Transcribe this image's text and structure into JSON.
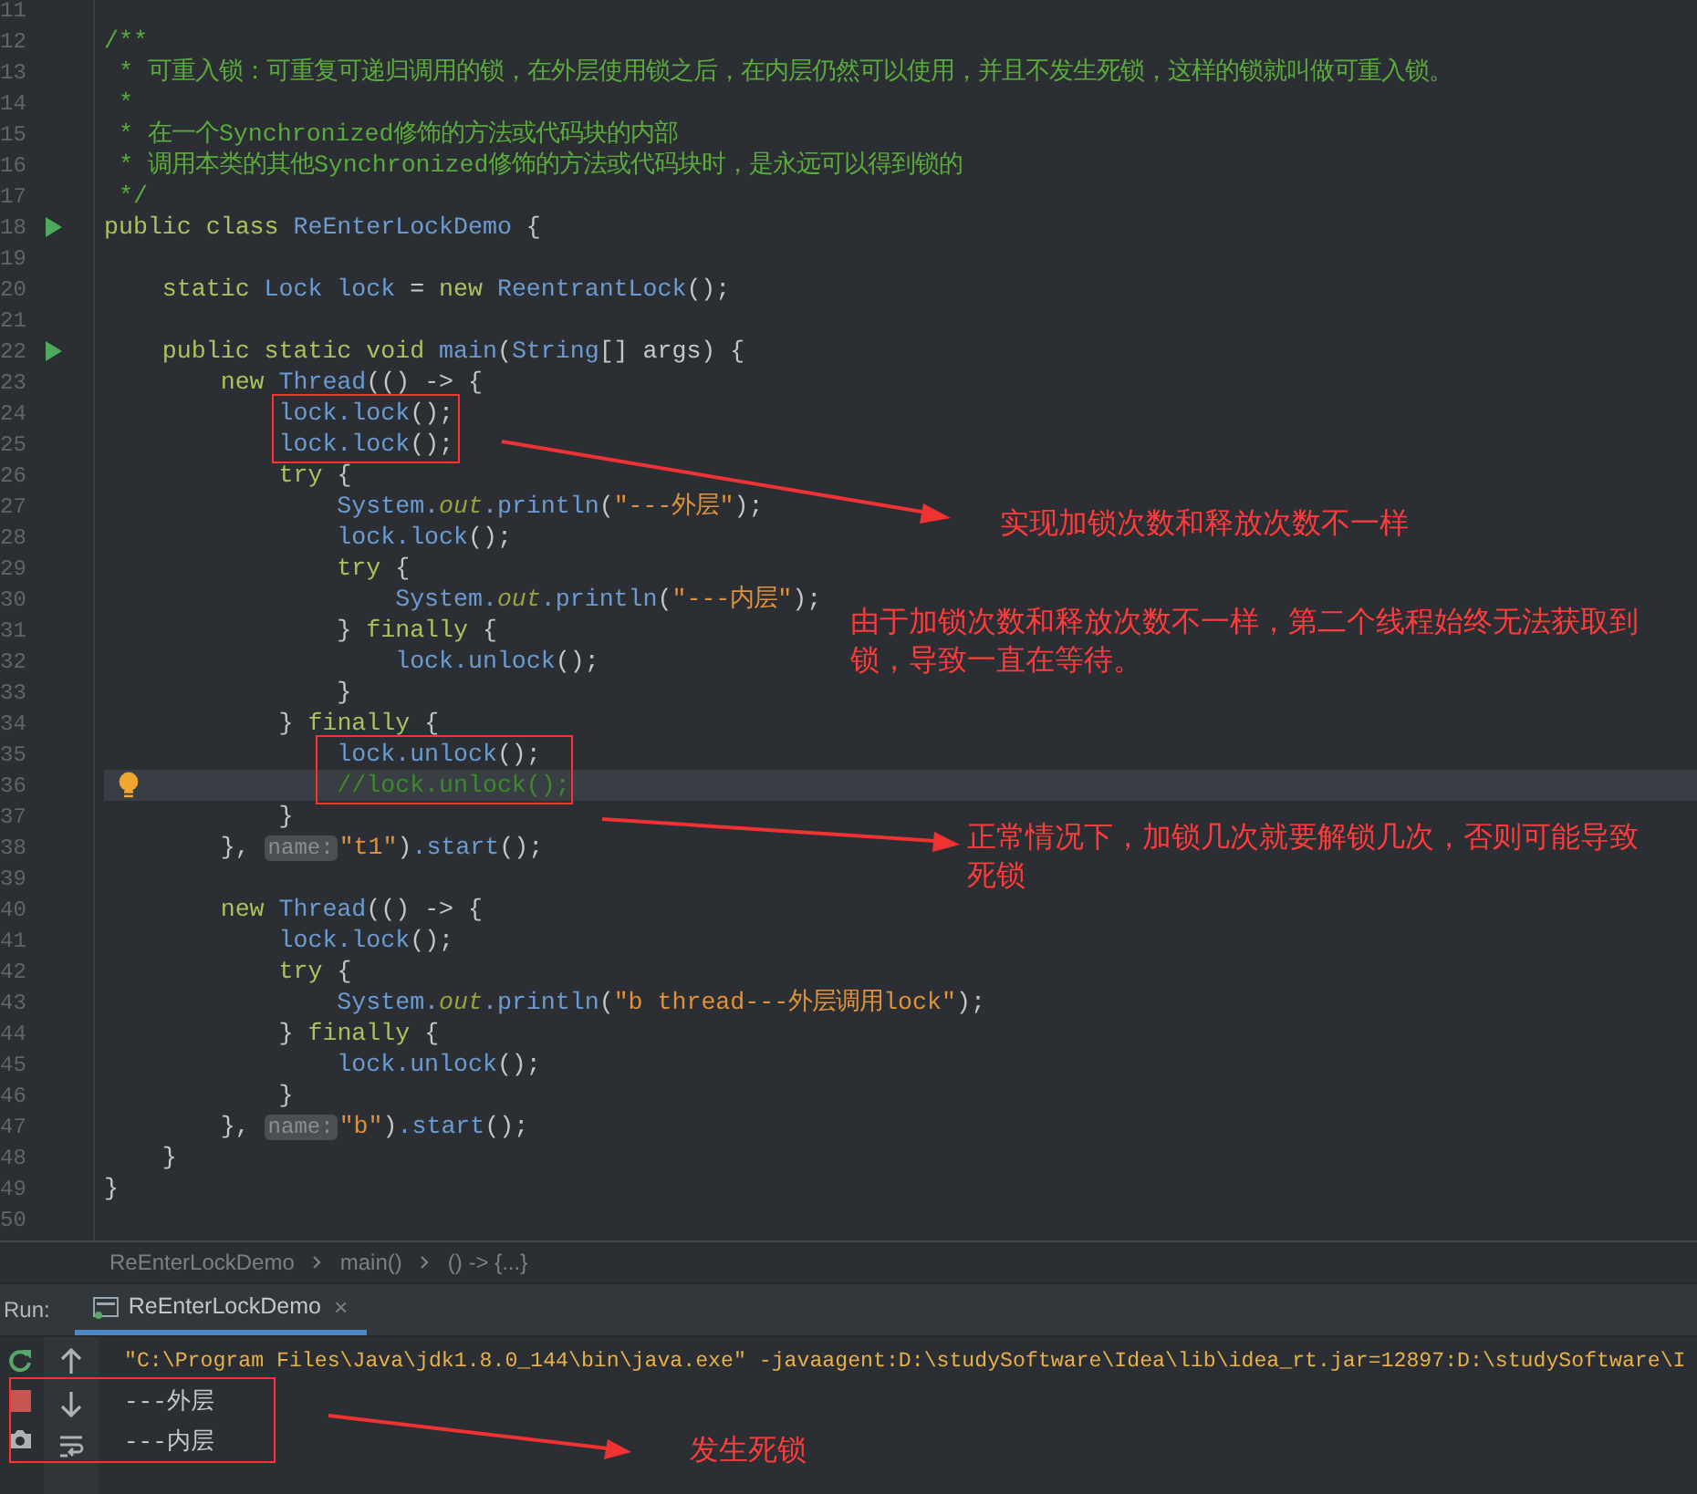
{
  "editor": {
    "lines": [
      {
        "number": "11",
        "current": false
      },
      {
        "number": "12",
        "current": false,
        "tokens": [
          {
            "text": "/**",
            "kind": "comment"
          }
        ]
      },
      {
        "number": "13",
        "current": false,
        "tokens": [
          {
            "text": " * 可重入锁：可重复可递归调用的锁，在外层使用锁之后，在内层仍然可以使用，并且不发生死锁，这样的锁就叫做可重入锁。",
            "kind": "comment"
          }
        ]
      },
      {
        "number": "14",
        "current": false,
        "tokens": [
          {
            "text": " *",
            "kind": "comment"
          }
        ]
      },
      {
        "number": "15",
        "current": false,
        "tokens": [
          {
            "text": " * 在一个Synchronized修饰的方法或代码块的内部",
            "kind": "comment"
          }
        ]
      },
      {
        "number": "16",
        "current": false,
        "tokens": [
          {
            "text": " * 调用本类的其他Synchronized修饰的方法或代码块时，是永远可以得到锁的",
            "kind": "comment"
          }
        ]
      },
      {
        "number": "17",
        "current": false,
        "tokens": [
          {
            "text": " */",
            "kind": "comment"
          }
        ]
      },
      {
        "number": "18",
        "current": false,
        "run_icon": true,
        "tokens": [
          {
            "text": "public class ",
            "kind": "keyword"
          },
          {
            "text": "ReEnterLockDemo",
            "kind": "identifier"
          },
          {
            "text": " {",
            "kind": "plain"
          }
        ]
      },
      {
        "number": "19",
        "current": false
      },
      {
        "number": "20",
        "current": false,
        "tokens": [
          {
            "text": "    static ",
            "kind": "keyword"
          },
          {
            "text": "Lock lock ",
            "kind": "identifier"
          },
          {
            "text": "= ",
            "kind": "plain"
          },
          {
            "text": "new ",
            "kind": "keyword"
          },
          {
            "text": "ReentrantLock",
            "kind": "identifier"
          },
          {
            "text": "();",
            "kind": "plain"
          }
        ]
      },
      {
        "number": "21",
        "current": false
      },
      {
        "number": "22",
        "current": false,
        "run_icon": true,
        "tokens": [
          {
            "text": "    public static void ",
            "kind": "keyword"
          },
          {
            "text": "main",
            "kind": "identifier"
          },
          {
            "text": "(",
            "kind": "plain"
          },
          {
            "text": "String",
            "kind": "identifier"
          },
          {
            "text": "[] args) {",
            "kind": "plain"
          }
        ]
      },
      {
        "number": "23",
        "current": false,
        "tokens": [
          {
            "text": "        new ",
            "kind": "keyword"
          },
          {
            "text": "Thread",
            "kind": "identifier"
          },
          {
            "text": "(() -> {",
            "kind": "plain"
          }
        ]
      },
      {
        "number": "24",
        "current": false,
        "tokens": [
          {
            "text": "            lock.lock",
            "kind": "identifier"
          },
          {
            "text": "();",
            "kind": "plain"
          }
        ]
      },
      {
        "number": "25",
        "current": false,
        "tokens": [
          {
            "text": "            lock.lock",
            "kind": "identifier"
          },
          {
            "text": "();",
            "kind": "plain"
          }
        ]
      },
      {
        "number": "26",
        "current": false,
        "tokens": [
          {
            "text": "            try ",
            "kind": "keyword"
          },
          {
            "text": "{",
            "kind": "plain"
          }
        ]
      },
      {
        "number": "27",
        "current": false,
        "tokens": [
          {
            "text": "                System.",
            "kind": "identifier"
          },
          {
            "text": "out",
            "kind": "field"
          },
          {
            "text": ".println",
            "kind": "identifier"
          },
          {
            "text": "(",
            "kind": "plain"
          },
          {
            "text": "\"---外层\"",
            "kind": "string"
          },
          {
            "text": ");",
            "kind": "plain"
          }
        ]
      },
      {
        "number": "28",
        "current": false,
        "tokens": [
          {
            "text": "                lock.lock",
            "kind": "identifier"
          },
          {
            "text": "();",
            "kind": "plain"
          }
        ]
      },
      {
        "number": "29",
        "current": false,
        "tokens": [
          {
            "text": "                try ",
            "kind": "keyword"
          },
          {
            "text": "{",
            "kind": "plain"
          }
        ]
      },
      {
        "number": "30",
        "current": false,
        "tokens": [
          {
            "text": "                    System.",
            "kind": "identifier"
          },
          {
            "text": "out",
            "kind": "field"
          },
          {
            "text": ".println",
            "kind": "identifier"
          },
          {
            "text": "(",
            "kind": "plain"
          },
          {
            "text": "\"---内层\"",
            "kind": "string"
          },
          {
            "text": ");",
            "kind": "plain"
          }
        ]
      },
      {
        "number": "31",
        "current": false,
        "tokens": [
          {
            "text": "                } ",
            "kind": "plain"
          },
          {
            "text": "finally ",
            "kind": "keyword"
          },
          {
            "text": "{",
            "kind": "plain"
          }
        ]
      },
      {
        "number": "32",
        "current": false,
        "tokens": [
          {
            "text": "                    lock.unlock",
            "kind": "identifier"
          },
          {
            "text": "();",
            "kind": "plain"
          }
        ]
      },
      {
        "number": "33",
        "current": false,
        "tokens": [
          {
            "text": "                }",
            "kind": "plain"
          }
        ]
      },
      {
        "number": "34",
        "current": false,
        "tokens": [
          {
            "text": "            } ",
            "kind": "plain"
          },
          {
            "text": "finally ",
            "kind": "keyword"
          },
          {
            "text": "{",
            "kind": "plain"
          }
        ]
      },
      {
        "number": "35",
        "current": false,
        "tokens": [
          {
            "text": "                lock.unlock",
            "kind": "identifier"
          },
          {
            "text": "();",
            "kind": "plain"
          }
        ]
      },
      {
        "number": "36",
        "current": true,
        "bulb_icon": true,
        "tokens": [
          {
            "text": "                //lock.unlock();",
            "kind": "disabled_code"
          }
        ]
      },
      {
        "number": "37",
        "current": false,
        "tokens": [
          {
            "text": "            }",
            "kind": "plain"
          }
        ]
      },
      {
        "number": "38",
        "current": false,
        "tokens": [
          {
            "text": "        }, ",
            "kind": "plain"
          },
          {
            "text": "name:",
            "kind": "hint"
          },
          {
            "text": "\"t1\"",
            "kind": "string"
          },
          {
            "text": ")",
            "kind": "plain"
          },
          {
            "text": ".start",
            "kind": "identifier"
          },
          {
            "text": "();",
            "kind": "plain"
          }
        ]
      },
      {
        "number": "39",
        "current": false
      },
      {
        "number": "40",
        "current": false,
        "tokens": [
          {
            "text": "        new ",
            "kind": "keyword"
          },
          {
            "text": "Thread",
            "kind": "identifier"
          },
          {
            "text": "(() -> {",
            "kind": "plain"
          }
        ]
      },
      {
        "number": "41",
        "current": false,
        "tokens": [
          {
            "text": "            lock.lock",
            "kind": "identifier"
          },
          {
            "text": "();",
            "kind": "plain"
          }
        ]
      },
      {
        "number": "42",
        "current": false,
        "tokens": [
          {
            "text": "            try ",
            "kind": "keyword"
          },
          {
            "text": "{",
            "kind": "plain"
          }
        ]
      },
      {
        "number": "43",
        "current": false,
        "tokens": [
          {
            "text": "                System.",
            "kind": "identifier"
          },
          {
            "text": "out",
            "kind": "field"
          },
          {
            "text": ".println",
            "kind": "identifier"
          },
          {
            "text": "(",
            "kind": "plain"
          },
          {
            "text": "\"b thread---外层调用lock\"",
            "kind": "string"
          },
          {
            "text": ");",
            "kind": "plain"
          }
        ]
      },
      {
        "number": "44",
        "current": false,
        "tokens": [
          {
            "text": "            } ",
            "kind": "plain"
          },
          {
            "text": "finally ",
            "kind": "keyword"
          },
          {
            "text": "{",
            "kind": "plain"
          }
        ]
      },
      {
        "number": "45",
        "current": false,
        "tokens": [
          {
            "text": "                lock.unlock",
            "kind": "identifier"
          },
          {
            "text": "();",
            "kind": "plain"
          }
        ]
      },
      {
        "number": "46",
        "current": false,
        "tokens": [
          {
            "text": "            }",
            "kind": "plain"
          }
        ]
      },
      {
        "number": "47",
        "current": false,
        "tokens": [
          {
            "text": "        }, ",
            "kind": "plain"
          },
          {
            "text": "name:",
            "kind": "hint"
          },
          {
            "text": "\"b\"",
            "kind": "string"
          },
          {
            "text": ")",
            "kind": "plain"
          },
          {
            "text": ".start",
            "kind": "identifier"
          },
          {
            "text": "();",
            "kind": "plain"
          }
        ]
      },
      {
        "number": "48",
        "current": false,
        "tokens": [
          {
            "text": "    }",
            "kind": "plain"
          }
        ]
      },
      {
        "number": "49",
        "current": false,
        "tokens": [
          {
            "text": "}",
            "kind": "plain"
          }
        ]
      },
      {
        "number": "50",
        "current": false
      }
    ]
  },
  "breadcrumbs": [
    "ReEnterLockDemo",
    "main()",
    "() -> {...}"
  ],
  "run_panel": {
    "label": "Run:",
    "tabs": [
      {
        "label": "ReEnterLockDemo",
        "selected": true,
        "close": "×"
      }
    ],
    "console_lines": [
      {
        "text": "\"C:\\Program Files\\Java\\jdk1.8.0_144\\bin\\java.exe\" -javaagent:D:\\studySoftware\\Idea\\lib\\idea_rt.jar=12897:D:\\studySoftware\\I",
        "kind": "command"
      },
      {
        "text": "---外层",
        "kind": "output"
      },
      {
        "text": "---内层",
        "kind": "output"
      }
    ]
  },
  "annotations": [
    {
      "text": "实现加锁次数和释放次数不一样"
    },
    {
      "text": "由于加锁次数和释放次数不一样，第二个线程始终无法获取到锁，导致一直在等待。"
    },
    {
      "text": "正常情况下，加锁几次就要解锁几次，否则可能导致死锁"
    },
    {
      "text": "发生死锁"
    }
  ]
}
